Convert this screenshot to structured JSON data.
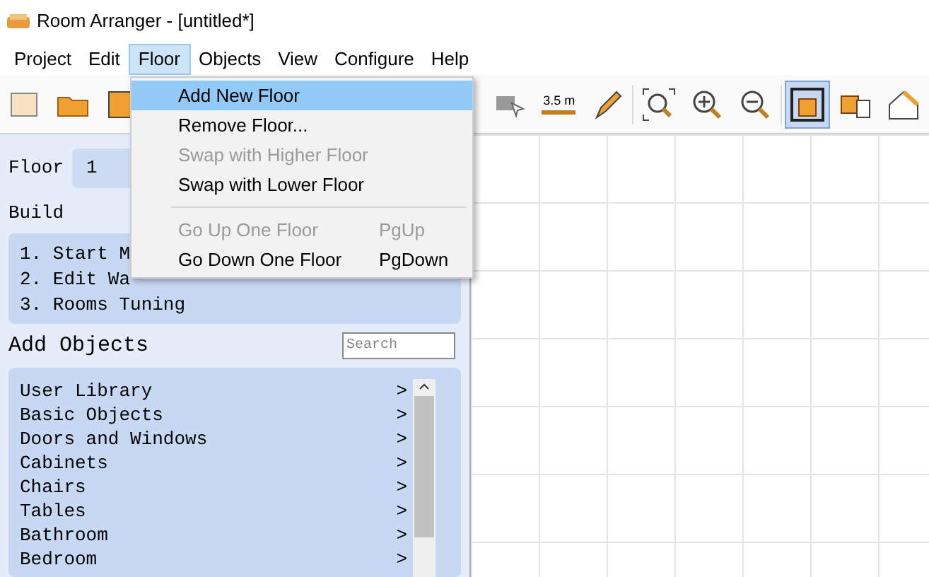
{
  "window": {
    "title": "Room Arranger - [untitled*]"
  },
  "menu_bar": [
    {
      "label": "Project",
      "selected": false
    },
    {
      "label": "Edit",
      "selected": false
    },
    {
      "label": "Floor",
      "selected": true
    },
    {
      "label": "Objects",
      "selected": false
    },
    {
      "label": "View",
      "selected": false
    },
    {
      "label": "Configure",
      "selected": false
    },
    {
      "label": "Help",
      "selected": false
    }
  ],
  "toolbar": {
    "measure_label": "3.5 m",
    "view_selected": true
  },
  "floor_menu": [
    {
      "kind": "item",
      "label": "Add New Floor",
      "selected": true,
      "disabled": false
    },
    {
      "kind": "item",
      "label": "Remove Floor...",
      "selected": false,
      "disabled": false
    },
    {
      "kind": "item",
      "label": "Swap with Higher Floor",
      "selected": false,
      "disabled": true
    },
    {
      "kind": "item",
      "label": "Swap with Lower Floor",
      "selected": false,
      "disabled": false
    },
    {
      "kind": "separator"
    },
    {
      "kind": "item",
      "label": "Go Up One Floor",
      "shortcut": "PgUp",
      "selected": false,
      "disabled": true
    },
    {
      "kind": "item",
      "label": "Go Down One Floor",
      "shortcut": "PgDown",
      "selected": false,
      "disabled": false
    }
  ],
  "sidebar": {
    "floor_label": "Floor",
    "floor_value": "1",
    "build_title": "Build",
    "build_steps": [
      "1. Start M",
      "2. Edit Wa",
      "3. Rooms Tuning"
    ],
    "objects_title": "Add Objects",
    "search": {
      "placeholder": "Search"
    },
    "categories": [
      "User Library",
      "Basic Objects",
      "Doors and Windows",
      "Cabinets",
      "Chairs",
      "Tables",
      "Bathroom",
      "Bedroom"
    ],
    "chevron": ">"
  }
}
